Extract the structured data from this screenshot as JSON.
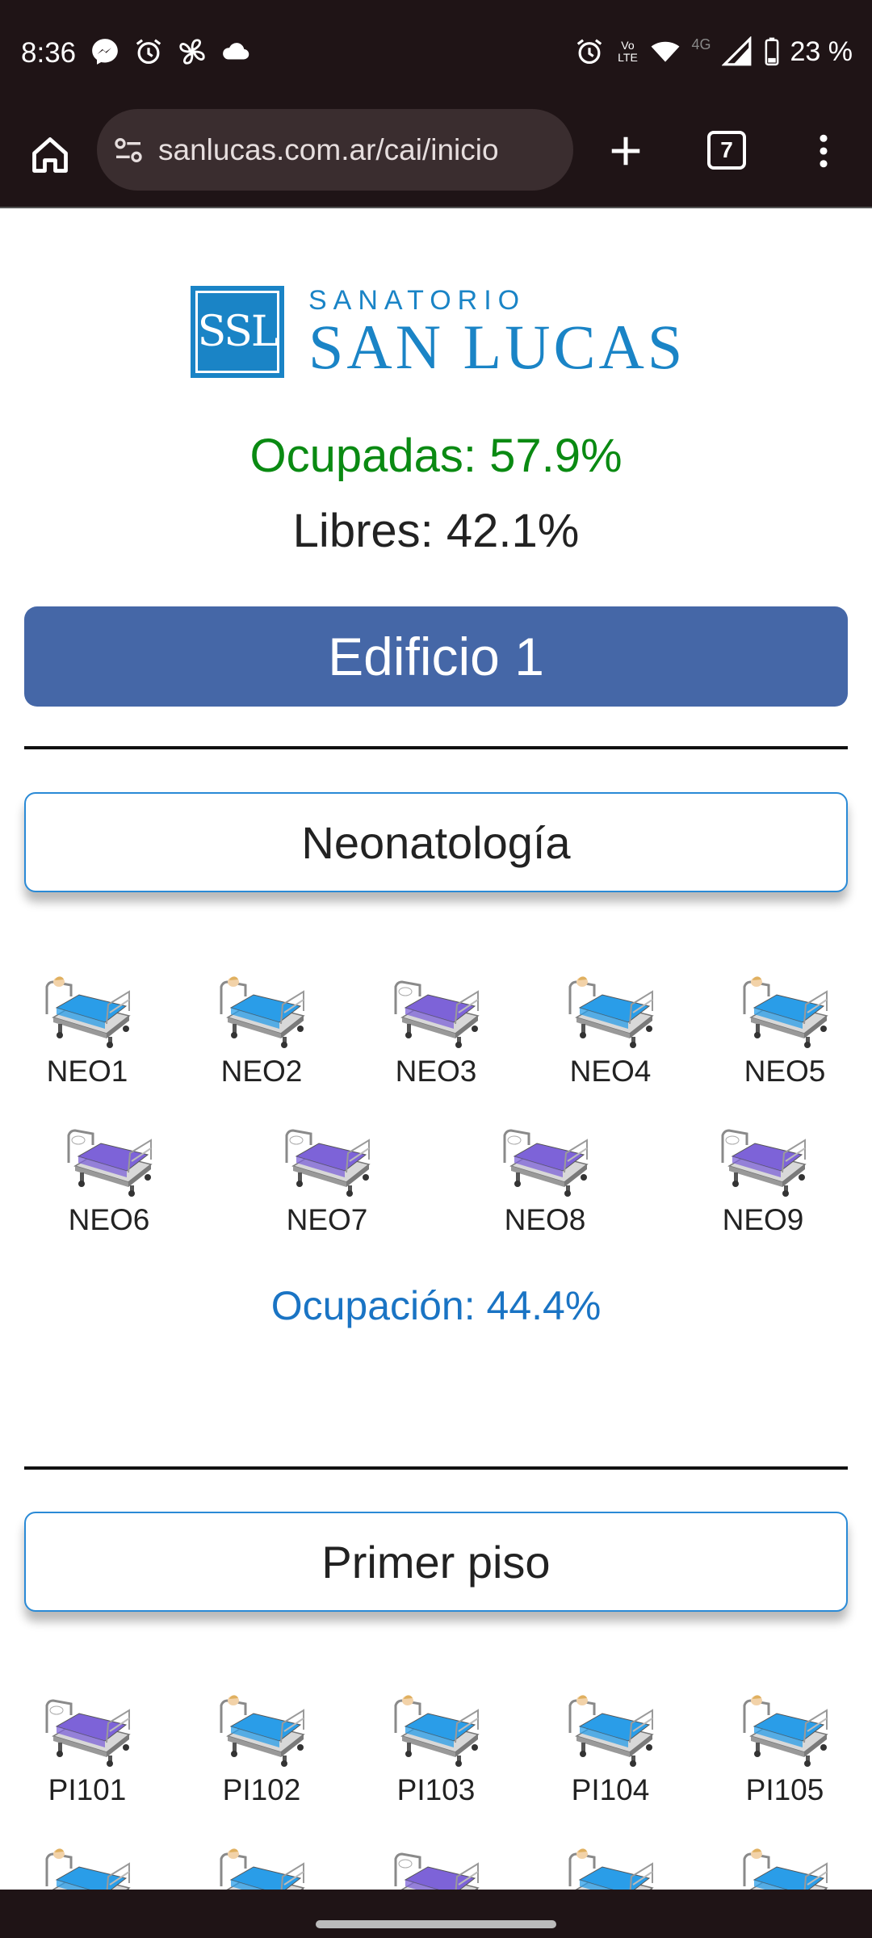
{
  "status_bar": {
    "time": "8:36",
    "left_icons": [
      "messenger-icon",
      "alarm-icon",
      "fan-icon",
      "cloud-icon"
    ],
    "right_icons": [
      "alarm-icon",
      "volte-icon",
      "wifi-icon",
      "signal-icon",
      "battery-icon"
    ],
    "network": "4G",
    "volte": "Vo LTE",
    "battery": "23 %"
  },
  "browser": {
    "url": "sanlucas.com.ar/cai/inicio",
    "tab_count": "7"
  },
  "logo": {
    "mark": "SSL",
    "line1": "SANATORIO",
    "line2": "SAN LUCAS"
  },
  "summary": {
    "occupied": "Ocupadas: 57.9%",
    "free": "Libres: 42.1%"
  },
  "building": {
    "label": "Edificio 1"
  },
  "sections": [
    {
      "title": "Neonatología",
      "occupancy": "Ocupación: 44.4%",
      "beds": [
        {
          "label": "NEO1",
          "status": "occupied"
        },
        {
          "label": "NEO2",
          "status": "occupied"
        },
        {
          "label": "NEO3",
          "status": "free"
        },
        {
          "label": "NEO4",
          "status": "occupied"
        },
        {
          "label": "NEO5",
          "status": "occupied"
        },
        {
          "label": "NEO6",
          "status": "free"
        },
        {
          "label": "NEO7",
          "status": "free"
        },
        {
          "label": "NEO8",
          "status": "free"
        },
        {
          "label": "NEO9",
          "status": "free"
        }
      ]
    },
    {
      "title": "Primer piso",
      "beds": [
        {
          "label": "PI101",
          "status": "free"
        },
        {
          "label": "PI102",
          "status": "occupied"
        },
        {
          "label": "PI103",
          "status": "occupied"
        },
        {
          "label": "PI104",
          "status": "occupied"
        },
        {
          "label": "PI105",
          "status": "occupied"
        },
        {
          "label": "",
          "status": "occupied"
        },
        {
          "label": "",
          "status": "occupied"
        },
        {
          "label": "",
          "status": "free"
        },
        {
          "label": "",
          "status": "occupied"
        },
        {
          "label": "",
          "status": "occupied"
        }
      ]
    }
  ],
  "colors": {
    "occupied_bed": "#2a9de8",
    "free_bed": "#7d63d8",
    "brand_blue": "#1a84c6",
    "building_bar": "#4567a7",
    "occupied_text": "#0a8a12",
    "section_occupancy_text": "#1a74c4"
  }
}
